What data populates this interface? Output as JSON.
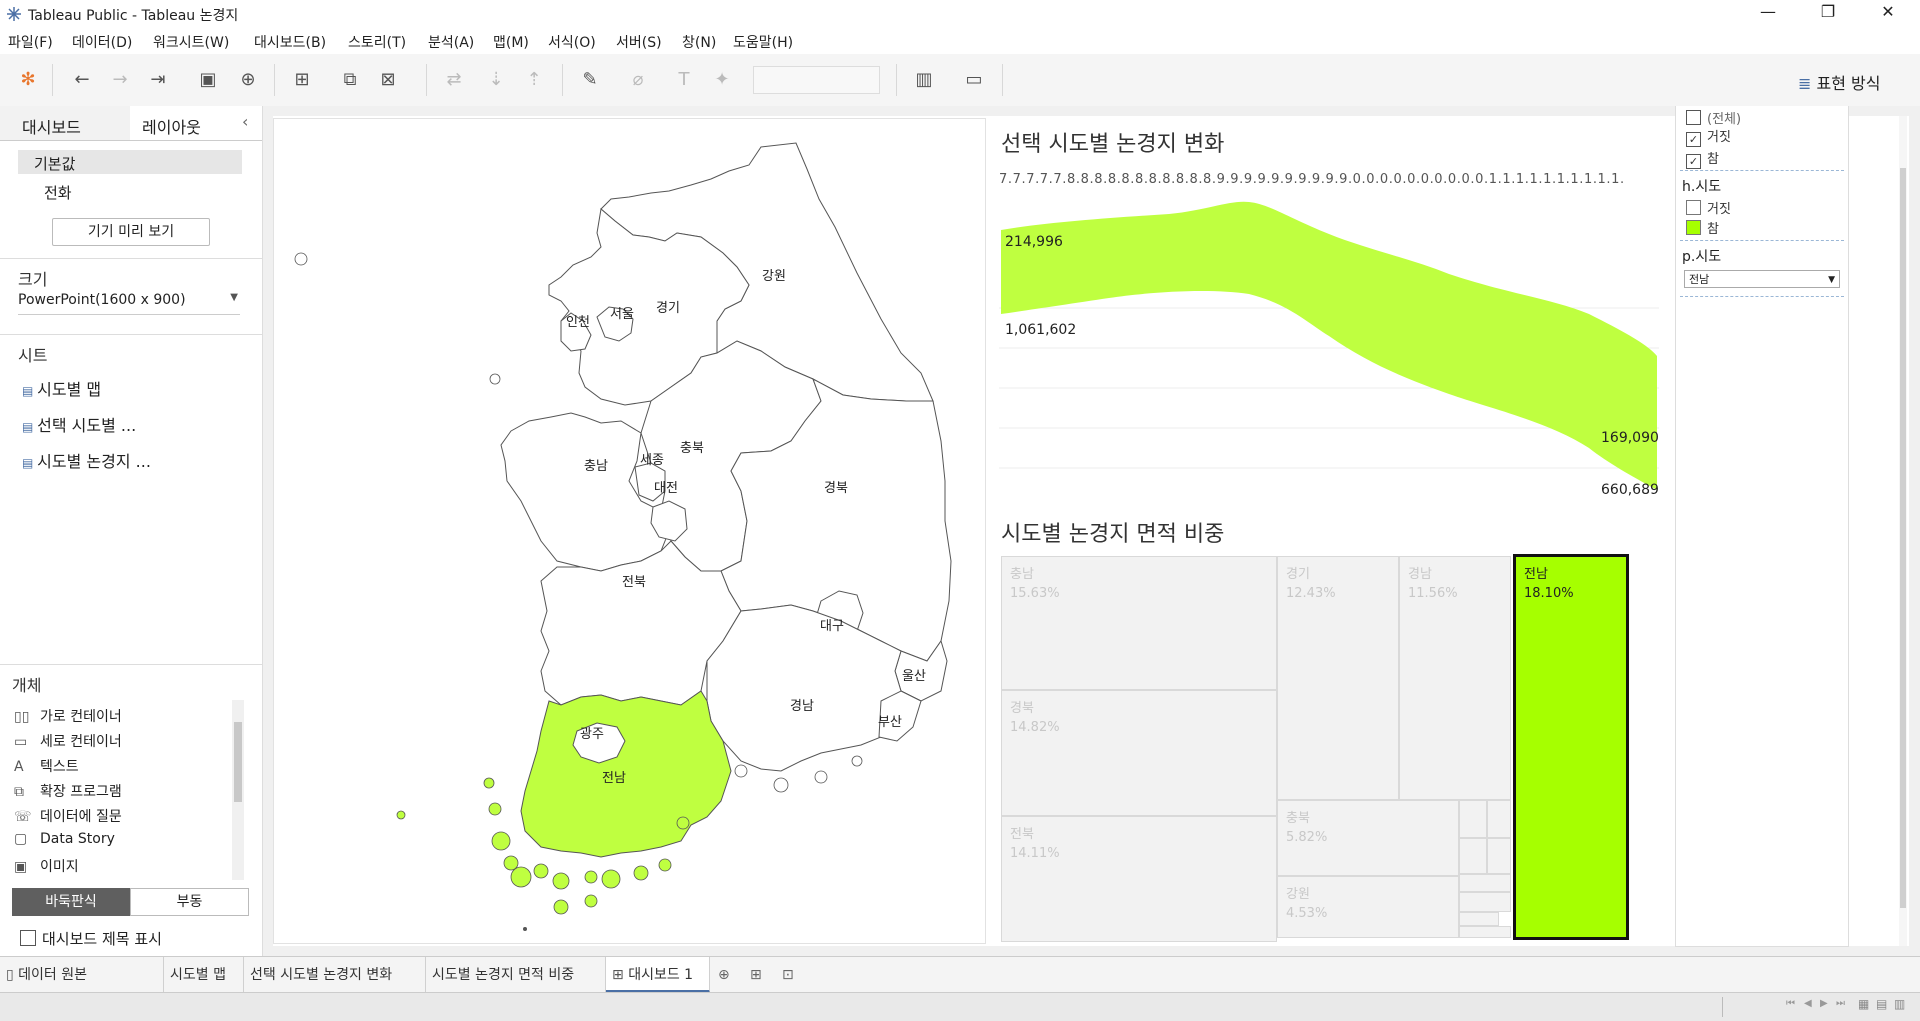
{
  "window": {
    "title": "Tableau Public - Tableau 논경지",
    "minimize": "—",
    "maximize": "❐",
    "close": "✕"
  },
  "menu": [
    "파일(F)",
    "데이터(D)",
    "워크시트(W)",
    "대시보드(B)",
    "스토리(T)",
    "분석(A)",
    "맵(M)",
    "서식(O)",
    "서버(S)",
    "창(N)",
    "도움말(H)"
  ],
  "toolbar": {
    "show_me": "표현 방식"
  },
  "left_pane": {
    "tabs": [
      "대시보드",
      "레이아웃"
    ],
    "collapse_icon": "‹",
    "devices": [
      "기본값",
      "전화"
    ],
    "preview_button": "기기 미리 보기",
    "size_heading": "크기",
    "size_value": "PowerPoint(1600 x 900)",
    "sheets_heading": "시트",
    "sheets": [
      "시도별 맵",
      "선택 시도별 ...",
      "시도별 논경지 ..."
    ],
    "objects_heading": "개체",
    "objects": [
      {
        "icon": "▯▯",
        "label": "가로 컨테이너"
      },
      {
        "icon": "▭",
        "label": "세로 컨테이너"
      },
      {
        "icon": "A",
        "label": "텍스트"
      },
      {
        "icon": "⧉",
        "label": "확장 프로그램"
      },
      {
        "icon": "☏",
        "label": "데이터에 질문"
      },
      {
        "icon": "▢",
        "label": "Data Story"
      },
      {
        "icon": "▣",
        "label": "이미지"
      }
    ],
    "layout_toggle": [
      "바둑판식",
      "부동"
    ],
    "show_title": "대시보드 제목 표시"
  },
  "map": {
    "labels": [
      "강원",
      "경기",
      "서울",
      "인천",
      "충남",
      "세종",
      "충북",
      "대전",
      "경북",
      "전북",
      "대구",
      "울산",
      "경남",
      "부산",
      "광주",
      "전남"
    ],
    "highlight_color": "#bfff40"
  },
  "line_chart": {
    "title": "선택 시도별 논경지 변화",
    "axis_text": "7.7.7.7.7.8.8.8.8.8.8.8.8.8.8.8.9.9.9.9.9.9.9.9.9.9.0.0.0.0.0.0.0.0.0.0.1.1.1.1.1.1.1.1.1.1.",
    "labels": [
      "214,996",
      "1,061,602",
      "169,090",
      "660,689"
    ],
    "band_color": "#bfff40"
  },
  "treemap": {
    "title": "시도별 논경지 면적 비중",
    "cells": [
      {
        "name": "충남",
        "pct": "15.63%"
      },
      {
        "name": "경북",
        "pct": "14.82%"
      },
      {
        "name": "전북",
        "pct": "14.11%"
      },
      {
        "name": "경기",
        "pct": "12.43%"
      },
      {
        "name": "경남",
        "pct": "11.56%"
      },
      {
        "name": "충북",
        "pct": "5.82%"
      },
      {
        "name": "강원",
        "pct": "4.53%"
      },
      {
        "name": "전남",
        "pct": "18.10%"
      }
    ],
    "highlight_color": "#a6ff00"
  },
  "filters": {
    "top_partial": "(전체)",
    "top_items": [
      {
        "label": "거짓",
        "checked": true
      },
      {
        "label": "참",
        "checked": true
      }
    ],
    "h_title": "h.시도",
    "h_items": [
      {
        "label": "거짓",
        "color": "#ffffff"
      },
      {
        "label": "참",
        "color": "#a6ff00"
      }
    ],
    "p_title": "p.시도",
    "p_value": "전남"
  },
  "sheet_tabs": [
    "데이터 원본",
    "시도별 맵",
    "선택 시도별 논경지 변화",
    "시도별 논경지 면적 비중",
    "대시보드 1"
  ],
  "status_nav": [
    "⏮",
    "◀",
    "▶",
    "⏭",
    "▦",
    "▤",
    "▥"
  ]
}
